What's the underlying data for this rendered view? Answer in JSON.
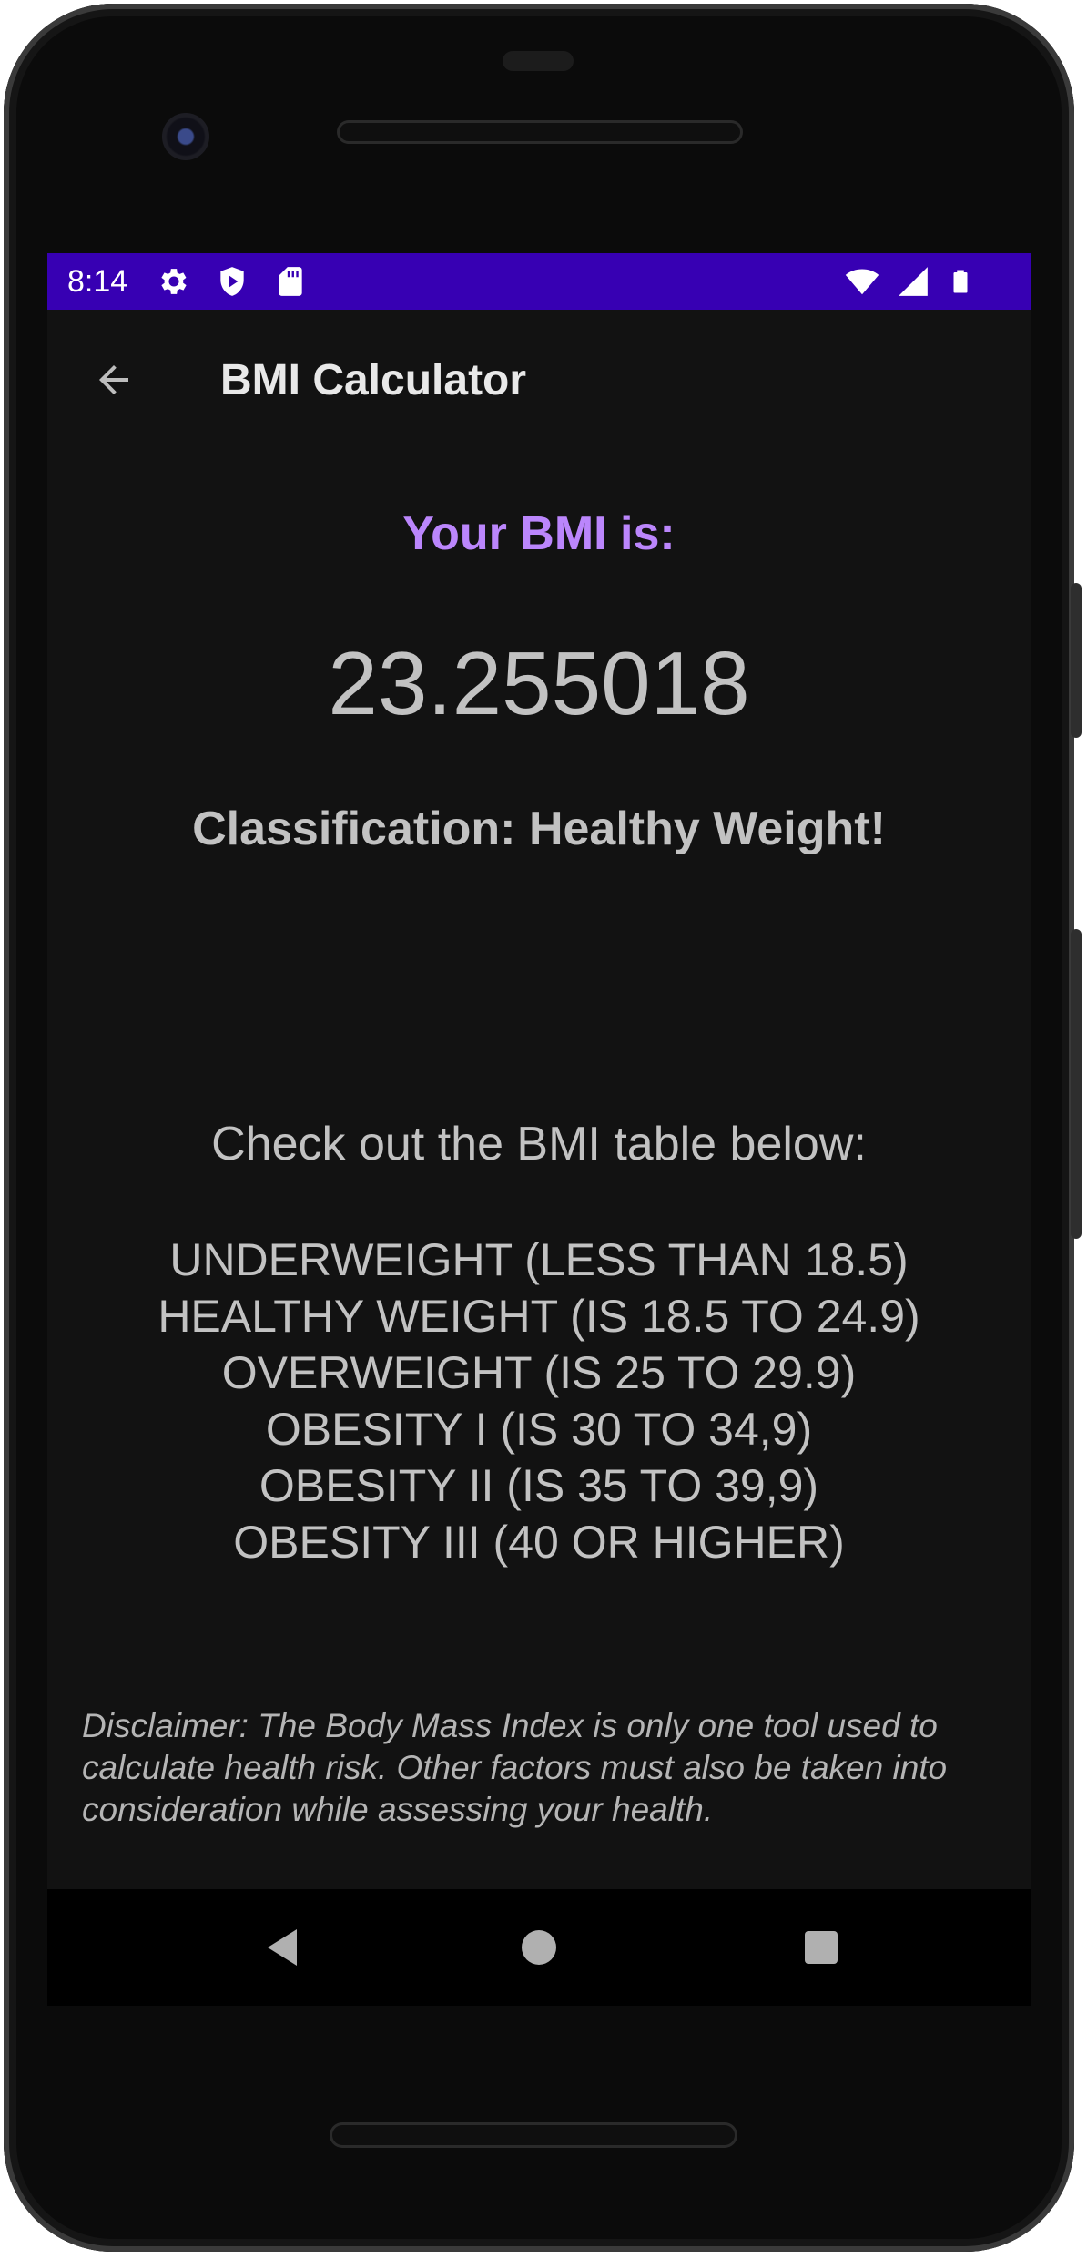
{
  "status_bar": {
    "time": "8:14",
    "left_icons": [
      "gear-icon",
      "shield-play-icon",
      "sd-card-icon"
    ],
    "right_icons": [
      "wifi-icon",
      "signal-icon",
      "battery-icon"
    ],
    "background_color": "#3700b3"
  },
  "app_bar": {
    "title": "BMI Calculator",
    "back_icon": "arrow-back-icon"
  },
  "result": {
    "heading": "Your BMI is:",
    "value": "23.255018",
    "classification": "Classification: Healthy Weight!",
    "accent_color": "#bb86fc"
  },
  "bmi_table": {
    "intro": "Check out the BMI table below:",
    "rows": [
      "UNDERWEIGHT (LESS THAN 18.5)",
      "HEALTHY WEIGHT (IS 18.5 TO 24.9)",
      "OVERWEIGHT (IS 25 TO 29.9)",
      "OBESITY I (IS 30 TO 34,9)",
      "OBESITY II (IS 35 TO 39,9)",
      "OBESITY III (40 OR HIGHER)"
    ]
  },
  "disclaimer": "Disclaimer: The Body Mass Index is only one tool used to calculate health risk. Other factors must also be taken into consideration while assessing your health.",
  "nav_bar": {
    "buttons": [
      "back-triangle-icon",
      "home-circle-icon",
      "recents-square-icon"
    ]
  }
}
